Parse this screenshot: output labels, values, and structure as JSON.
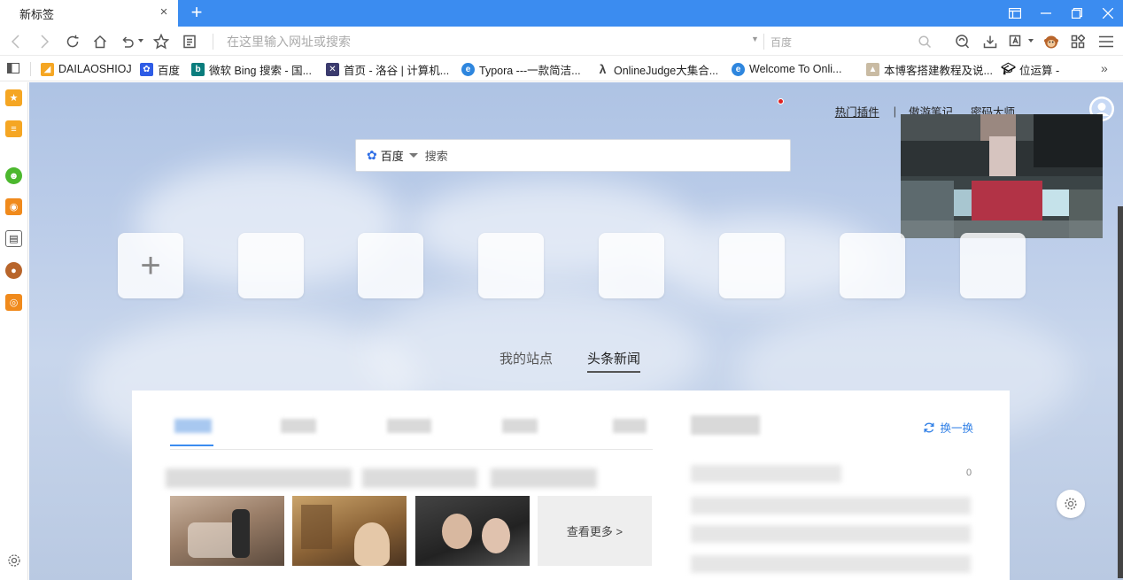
{
  "tab": {
    "title": "新标签",
    "close_glyph": "×",
    "new_tab_glyph": "+"
  },
  "toolbar": {
    "address_placeholder": "在这里输入网址或搜索",
    "engine_label": "百度"
  },
  "bookmarks": [
    {
      "label": "DAILAOSHIOJ",
      "icon": "dailaoshi-icon",
      "color": "#f5a623"
    },
    {
      "label": "百度",
      "icon": "baidu-paw-icon",
      "color": "#2e5ce6"
    },
    {
      "label": "微软 Bing 搜索 - 国...",
      "icon": "bing-icon",
      "color": "#0a7d7d"
    },
    {
      "label": "首页 - 洛谷 | 计算机...",
      "icon": "luogu-icon",
      "color": "#3b3b6e"
    },
    {
      "label": "Typora ---一款简洁...",
      "icon": "ie-icon",
      "color": "#2e86de"
    },
    {
      "label": "OnlineJudge大集合...",
      "icon": "lambda-icon",
      "color": "#444444"
    },
    {
      "label": "Welcome To Onli...",
      "icon": "ie-icon",
      "color": "#2e86de"
    },
    {
      "label": "本博客搭建教程及说...",
      "icon": "blog-icon",
      "color": "#8a7a66"
    },
    {
      "label": "位运算 -",
      "icon": "graduation-cap-icon",
      "color": "#111111"
    }
  ],
  "page": {
    "top_links": {
      "hot_plugins": "热门插件",
      "separator": "|",
      "notes": "傲游笔记",
      "password": "密码大师"
    },
    "search": {
      "engine": "百度",
      "placeholder": "搜索"
    },
    "add_tile_glyph": "+",
    "tabs": {
      "sites": "我的站点",
      "news": "头条新闻"
    },
    "news": {
      "refresh_label": "换一换",
      "more_label": "查看更多 >",
      "rank_first_value": "0"
    }
  },
  "colors": {
    "accent": "#3b8cf0",
    "link_blue": "#2f7fe6",
    "badge_red": "#e02020"
  }
}
